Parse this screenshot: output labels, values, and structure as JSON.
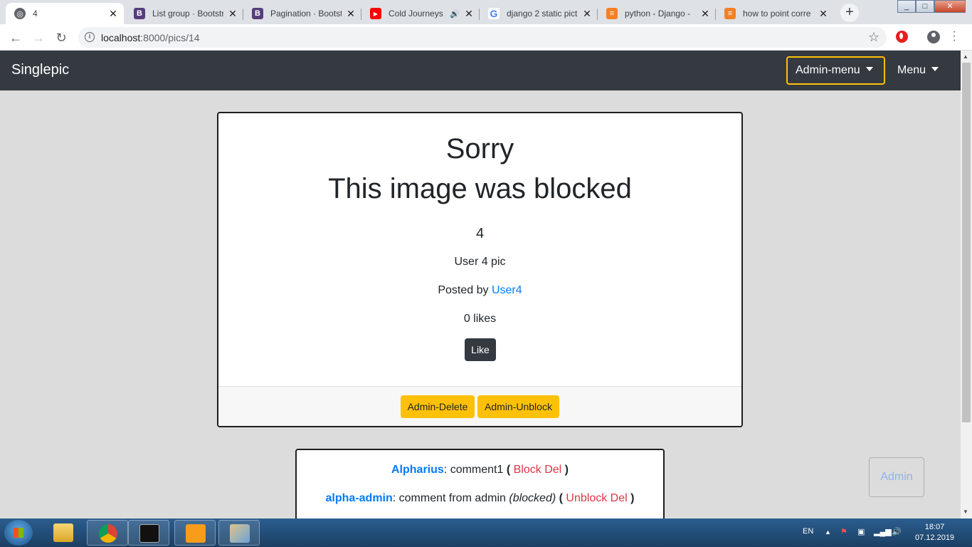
{
  "browser": {
    "tabs": [
      {
        "title": "4",
        "favicon": "globe-icon",
        "active": true
      },
      {
        "title": "List group · Bootstr",
        "favicon": "bootstrap-icon"
      },
      {
        "title": "Pagination · Bootstr",
        "favicon": "bootstrap-icon"
      },
      {
        "title": "Cold Journeys",
        "favicon": "youtube-icon",
        "audio": true
      },
      {
        "title": "django 2 static pict",
        "favicon": "google-icon"
      },
      {
        "title": "python - Django -",
        "favicon": "stackoverflow-icon"
      },
      {
        "title": "how to point corre",
        "favicon": "stackoverflow-icon"
      }
    ],
    "close_glyph": "✕",
    "new_tab_glyph": "+",
    "url_host": "localhost",
    "url_path": ":8000/pics/14"
  },
  "navbar": {
    "brand": "Singlepic",
    "admin_menu": "Admin-menu",
    "menu": "Menu"
  },
  "card": {
    "heading_1": "Sorry",
    "heading_2": "This image was blocked",
    "pic_title": "4",
    "description": "User 4 pic",
    "posted_by_prefix": "Posted by ",
    "posted_by_user": "User4",
    "likes": "0 likes",
    "like_button": "Like",
    "admin_delete": "Admin-Delete",
    "admin_unblock": "Admin-Unblock"
  },
  "comments": [
    {
      "user": "Alpharius",
      "text": ": comment1 ",
      "blocked_note": "",
      "action_1": "Block",
      "action_2": "Del"
    },
    {
      "user": "alpha-admin",
      "text": ": comment from admin ",
      "blocked_note": "(blocked)",
      "action_1": "Unblock",
      "action_2": "Del"
    }
  ],
  "admin_float_button": "Admin",
  "taskbar": {
    "lang": "EN",
    "time": "18:07",
    "date": "07.12.2019",
    "apps": [
      "explorer-icon",
      "chrome-icon",
      "cmd-icon",
      "sublime-icon",
      "paint-icon"
    ]
  },
  "colors": {
    "navbar": "#343a40",
    "warning": "#ffc107",
    "link": "#007bff",
    "danger": "#dc3545"
  }
}
